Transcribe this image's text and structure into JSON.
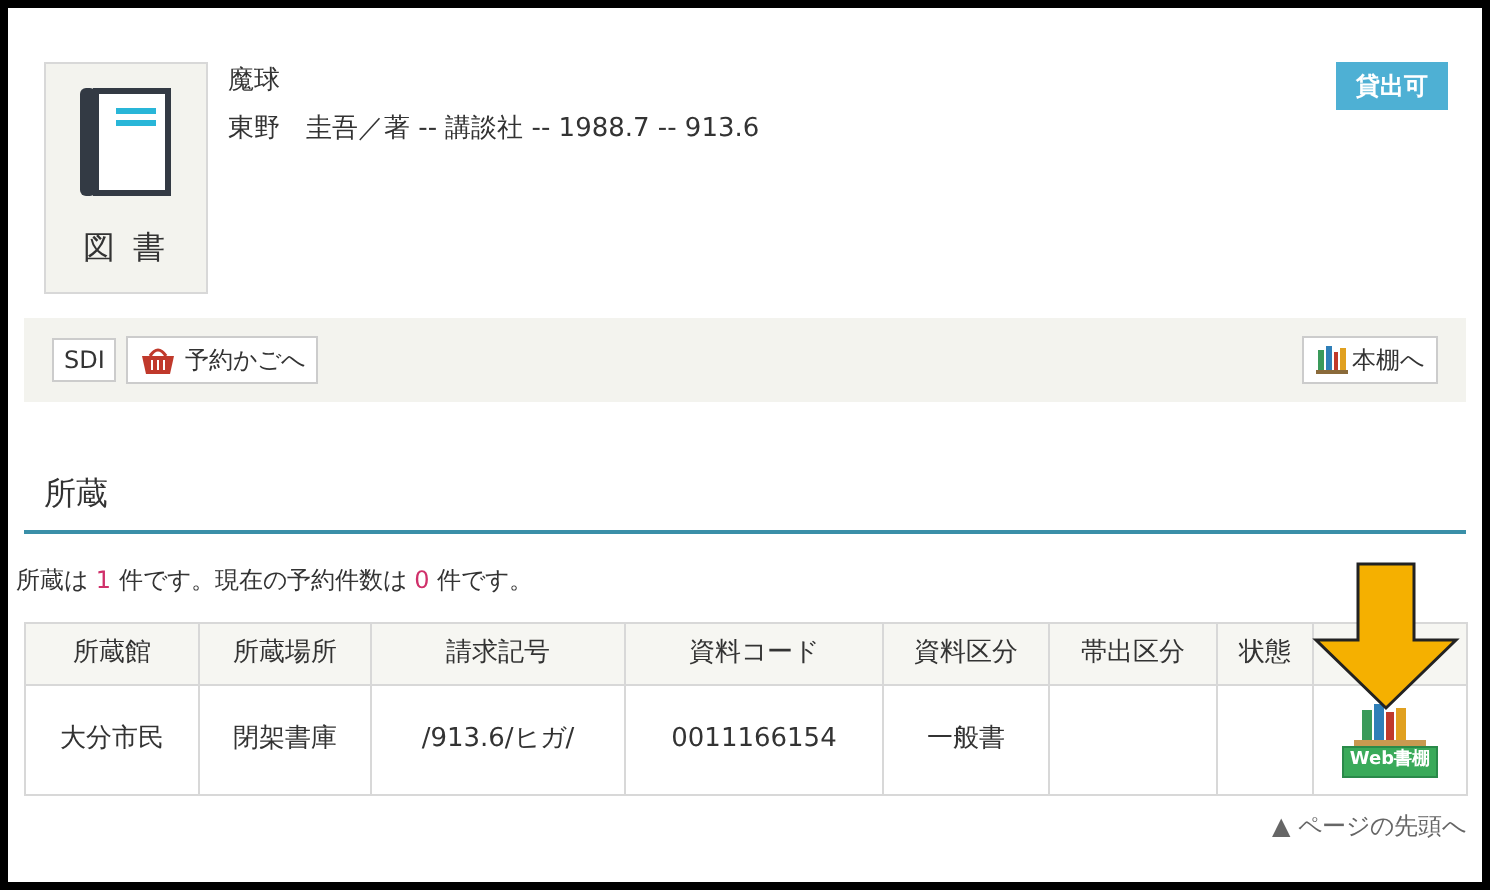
{
  "item": {
    "type_label": "図 書",
    "title": "魔球",
    "details": "東野　圭吾／著 -- 講談社 -- 1988.7 -- 913.6",
    "status_badge": "貸出可"
  },
  "toolbar": {
    "sdi_button": "SDI",
    "cart_button": "予約かごへ",
    "shelf_button": "本棚へ"
  },
  "holdings": {
    "heading": "所蔵",
    "summary": [
      {
        "kind": "text",
        "text": "所蔵は "
      },
      {
        "kind": "count",
        "text": "1"
      },
      {
        "kind": "text",
        "text": " 件です。現在の予約件数は "
      },
      {
        "kind": "count",
        "text": "0"
      },
      {
        "kind": "text",
        "text": " 件です。"
      }
    ],
    "table": {
      "columns": [
        "所蔵館",
        "所蔵場所",
        "請求記号",
        "資料コード",
        "資料区分",
        "帯出区分",
        "状態"
      ],
      "rows": [
        {
          "cells": [
            "大分市民",
            "閉架書庫",
            "/913.6/ヒガ/",
            "0011166154",
            "一般書",
            "",
            ""
          ],
          "web_shelf_button": "Web書棚"
        }
      ]
    }
  },
  "footer_link": "▲ ページの先頭へ"
}
